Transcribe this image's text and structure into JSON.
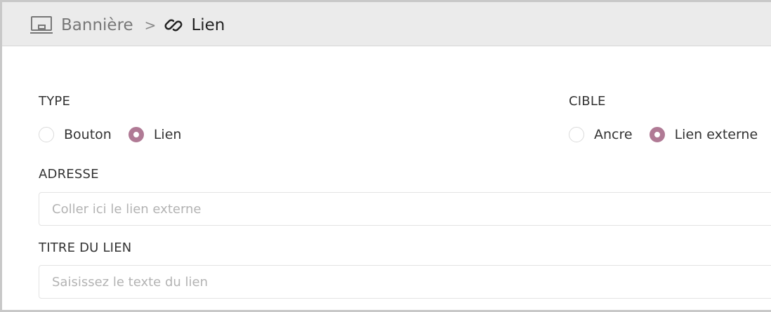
{
  "breadcrumb": {
    "parent_icon": "monitor-icon",
    "parent_label": "Bannière",
    "separator": ">",
    "current_icon": "link-icon",
    "current_label": "Lien"
  },
  "type_field": {
    "label": "TYPE",
    "options": [
      {
        "label": "Bouton",
        "selected": false
      },
      {
        "label": "Lien",
        "selected": true
      }
    ]
  },
  "cible_field": {
    "label": "CIBLE",
    "options": [
      {
        "label": "Ancre",
        "selected": false
      },
      {
        "label": "Lien externe",
        "selected": true
      }
    ]
  },
  "adresse_field": {
    "label": "ADRESSE",
    "value": "",
    "placeholder": "Coller ici le lien externe"
  },
  "titre_field": {
    "label": "TITRE DU LIEN",
    "value": "",
    "placeholder": "Saisissez le texte du lien"
  },
  "colors": {
    "accent": "#b07a95",
    "header_bg": "#ebebeb"
  }
}
